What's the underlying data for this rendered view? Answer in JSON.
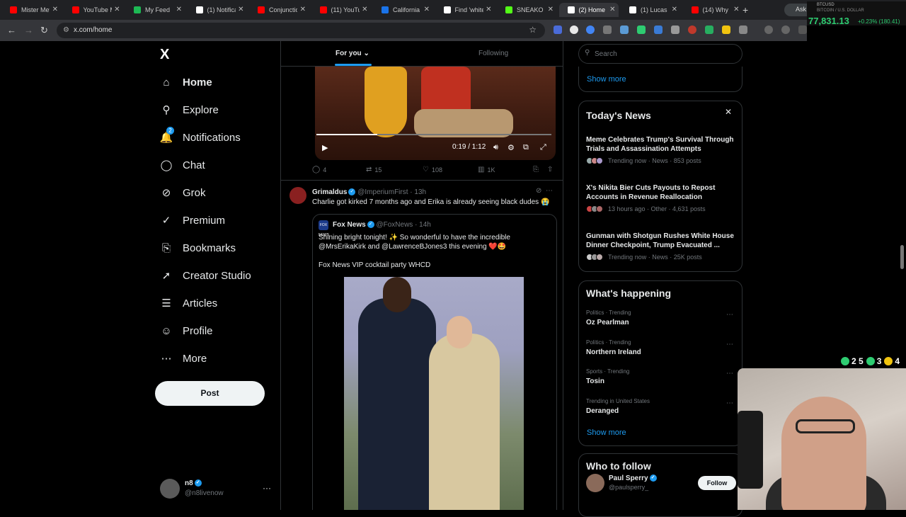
{
  "browser": {
    "tabs": [
      {
        "label": "Mister Met",
        "color": "#ff0000"
      },
      {
        "label": "YouTube M",
        "color": "#ff0000"
      },
      {
        "label": "My Feed",
        "color": "#1db954"
      },
      {
        "label": "(1) Notifica",
        "color": "#ffffff"
      },
      {
        "label": "Conjunctio",
        "color": "#ff0000"
      },
      {
        "label": "(11) YouTu",
        "color": "#ff0000"
      },
      {
        "label": "California",
        "color": "#1a73e8"
      },
      {
        "label": "Find 'white",
        "color": "#ffffff"
      },
      {
        "label": "SNEAKO S",
        "color": "#53fc18"
      },
      {
        "label": "(2) Home",
        "color": "#ffffff"
      },
      {
        "label": "(1) Lucas G",
        "color": "#ffffff"
      },
      {
        "label": "(14) Why",
        "color": "#ff0000"
      }
    ],
    "active_tab_index": 9,
    "new_tab": "+",
    "ask_label": "Ask",
    "url": "x.com/home"
  },
  "ticker": {
    "pair": "BTCUSD",
    "sub": "BITCOIN / U.S. DOLLAR",
    "price": "77,831.13",
    "change": "+0.23% (180.41)",
    "color": "#2ecc71"
  },
  "sidebar": {
    "logo": "X",
    "items": [
      {
        "label": "Home",
        "icon": "home-icon",
        "glyph": "⌂",
        "bold": true
      },
      {
        "label": "Explore",
        "icon": "search-icon",
        "glyph": "⚲"
      },
      {
        "label": "Notifications",
        "icon": "bell-icon",
        "glyph": "🔔",
        "badge": "2"
      },
      {
        "label": "Chat",
        "icon": "chat-icon",
        "glyph": "◯"
      },
      {
        "label": "Grok",
        "icon": "grok-icon",
        "glyph": "⊘"
      },
      {
        "label": "Premium",
        "icon": "premium-icon",
        "glyph": "✓"
      },
      {
        "label": "Bookmarks",
        "icon": "bookmark-icon",
        "glyph": "⎘"
      },
      {
        "label": "Creator Studio",
        "icon": "rocket-icon",
        "glyph": "➚"
      },
      {
        "label": "Articles",
        "icon": "article-icon",
        "glyph": "☰"
      },
      {
        "label": "Profile",
        "icon": "person-icon",
        "glyph": "☺"
      },
      {
        "label": "More",
        "icon": "more-icon",
        "glyph": "⋯"
      }
    ],
    "post_label": "Post",
    "account": {
      "name": "n8",
      "handle": "@n8livenow",
      "more": "···"
    }
  },
  "feed": {
    "tabs": [
      {
        "label": "For you",
        "chevron": "⌄"
      },
      {
        "label": "Following"
      }
    ],
    "video": {
      "time": "0:19 / 1:12",
      "progress": 0.26,
      "play": "▶"
    },
    "first_actions": {
      "replies": "4",
      "reposts": "15",
      "likes": "108",
      "views": "1K"
    },
    "tweet": {
      "name": "Grimaldus",
      "handle": "@ImperiumFirst",
      "time": "· 13h",
      "text": "Charlie got kirked 7 months ago and Erika is already seeing black dudes 😭",
      "quote": {
        "avatar_text": "FOX NEWS",
        "name": "Fox News",
        "handle": "@FoxNews",
        "time": "· 14h",
        "text": "Shining bright tonight! ✨ So wonderful to have the incredible @MrsErikaKirk and @LawrenceBJones3 this evening ❤️🤩",
        "text2": "Fox News VIP cocktail party WHCD"
      }
    }
  },
  "right": {
    "search_placeholder": "Search",
    "show_more": "Show more",
    "news": {
      "title": "Today's News",
      "close": "✕",
      "items": [
        {
          "title": "Meme Celebrates Trump's Survival Through Trials and Assassination Attempts",
          "meta": "Trending now · News · 853 posts"
        },
        {
          "title": "X's Nikita Bier Cuts Payouts to Repost Accounts in Revenue Reallocation",
          "meta": "13 hours ago · Other · 4,631 posts"
        },
        {
          "title": "Gunman with Shotgun Rushes White House Dinner Checkpoint, Trump Evacuated ...",
          "meta": "Trending now · News · 25K posts"
        }
      ]
    },
    "happening": {
      "title": "What's happening",
      "items": [
        {
          "meta": "Politics · Trending",
          "title": "Oz Pearlman"
        },
        {
          "meta": "Politics · Trending",
          "title": "Northern Ireland"
        },
        {
          "meta": "Sports · Trending",
          "title": "Tosin"
        },
        {
          "meta": "Trending in United States",
          "title": "Deranged"
        }
      ],
      "show_more": "Show more"
    },
    "who_to_follow": {
      "title": "Who to follow",
      "name": "Paul Sperry",
      "handle": "@paulsperry_",
      "follow_label": "Follow"
    }
  },
  "overlay_stats": [
    {
      "value": "2 5",
      "color": "#2ecc71"
    },
    {
      "value": "3",
      "color": "#2ecc71"
    },
    {
      "value": "4",
      "color": "#f1c40f"
    }
  ]
}
